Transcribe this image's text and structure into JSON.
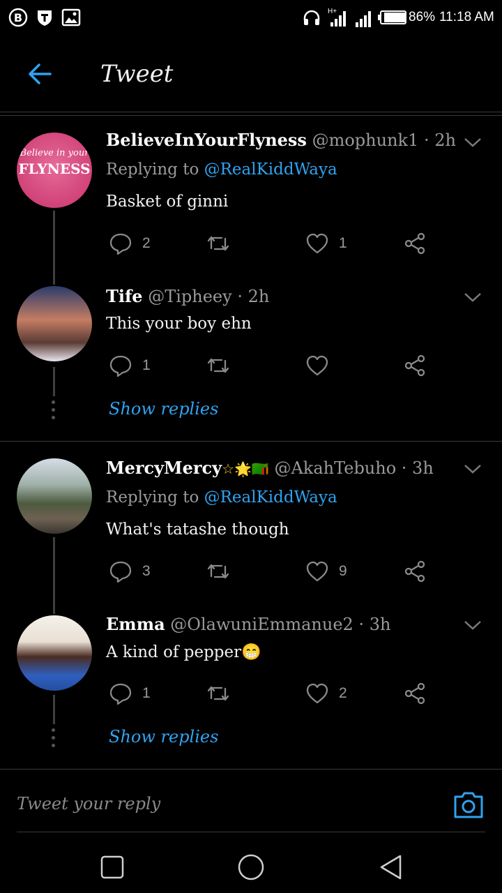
{
  "status_bar": {
    "network_type": "H+",
    "battery": "86%",
    "time": "11:18 AM"
  },
  "header": {
    "title": "Tweet"
  },
  "tweets": [
    {
      "name": "BelieveInYourFlyness",
      "handle": "@mophunk1 · 2h",
      "replying_label": "Replying to",
      "replying_to": "@RealKiddWaya",
      "text": "Basket of ginni",
      "avatar_text_1": "Believe in your",
      "avatar_text_2": "FLYNESS",
      "replies": "2",
      "retweets": "",
      "likes": "1"
    },
    {
      "name": "Tife",
      "handle": "@Tipheey · 2h",
      "text": "This your boy ehn",
      "replies": "1",
      "retweets": "",
      "likes": "",
      "show_replies": "Show replies"
    },
    {
      "name": "MercyMercy",
      "name_emoji": "☆🌟🇿🇲",
      "handle": "@AkahTebuho · 3h",
      "replying_label": "Replying to",
      "replying_to": "@RealKiddWaya",
      "text": "What's tatashe though",
      "replies": "3",
      "retweets": "",
      "likes": "9"
    },
    {
      "name": "Emma",
      "handle": "@OlawuniEmmanue2 · 3h",
      "text": "A kind of pepper😁",
      "replies": "1",
      "retweets": "",
      "likes": "2",
      "show_replies": "Show replies"
    }
  ],
  "reply_bar": {
    "placeholder": "Tweet your reply"
  },
  "colors": {
    "accent": "#2fa3f1",
    "background": "#000000",
    "muted": "#9a9a9a"
  },
  "icons": [
    "back-arrow-icon",
    "chevron-down-icon",
    "reply-icon",
    "retweet-icon",
    "like-icon",
    "share-icon",
    "camera-icon",
    "square-icon",
    "circle-icon",
    "triangle-back-icon"
  ]
}
